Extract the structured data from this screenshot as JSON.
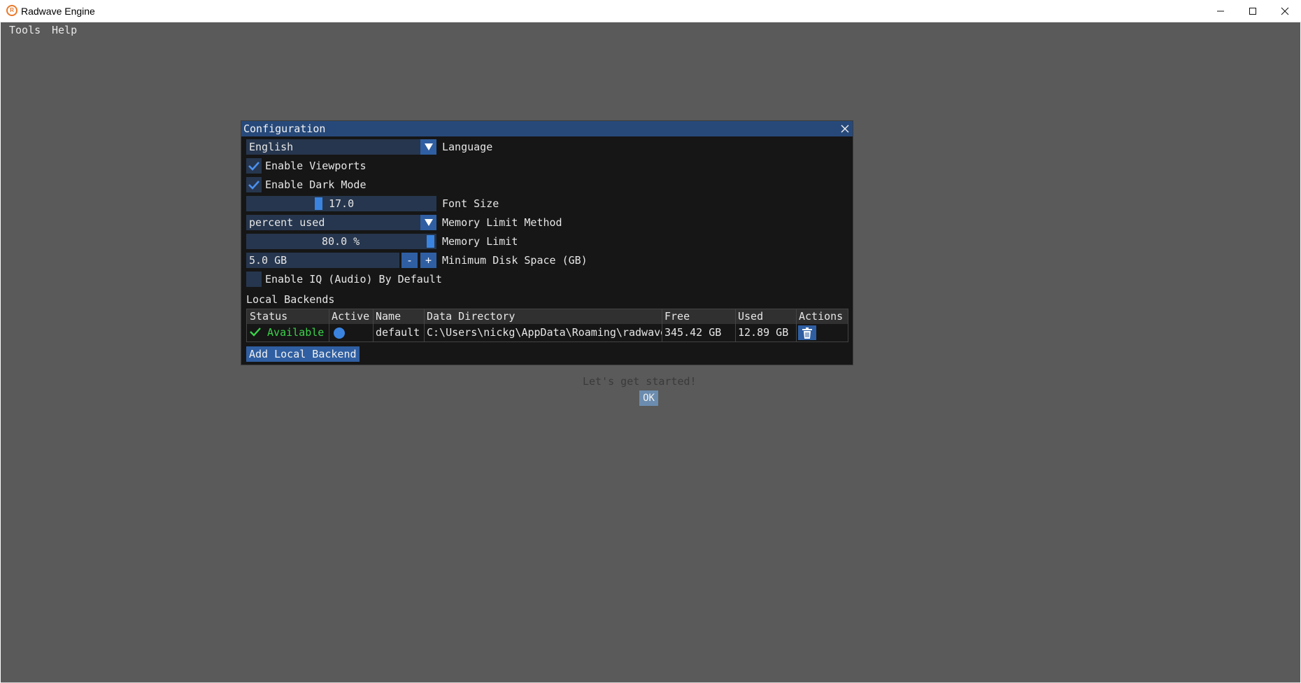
{
  "window": {
    "title": "Radwave Engine",
    "icon": "radwave-logo-icon"
  },
  "menu": {
    "items": [
      {
        "label": "Tools"
      },
      {
        "label": "Help"
      }
    ]
  },
  "background_modal": {
    "text": "Let's get started!",
    "ok_label": "OK"
  },
  "config": {
    "title": "Configuration",
    "language": {
      "value": "English",
      "label": "Language"
    },
    "enable_viewports": {
      "label": "Enable Viewports",
      "checked": true
    },
    "enable_dark_mode": {
      "label": "Enable Dark Mode",
      "checked": true
    },
    "font_size": {
      "value": "17.0",
      "label": "Font Size"
    },
    "memory_limit_method": {
      "value": "percent used",
      "label": "Memory Limit Method"
    },
    "memory_limit": {
      "value": "80.0 %",
      "label": "Memory Limit"
    },
    "min_disk_space": {
      "value": "5.0 GB",
      "label": "Minimum Disk Space (GB)",
      "minus": "-",
      "plus": "+"
    },
    "enable_iq": {
      "label": "Enable IQ (Audio) By Default",
      "checked": false
    },
    "local_backends": {
      "section_label": "Local Backends",
      "columns": [
        "Status",
        "Active",
        "Name",
        "Data Directory",
        "Free",
        "Used",
        "Actions"
      ],
      "rows": [
        {
          "status": "Available",
          "active": true,
          "name": "default",
          "data_directory": "C:\\Users\\nickg\\AppData\\Roaming\\radwave",
          "free": "345.42 GB",
          "used": "12.89 GB"
        }
      ],
      "add_label": "Add Local Backend"
    }
  },
  "colors": {
    "accent": "#2f5fa2",
    "title_bar": "#27497a",
    "status_ok": "#3ad24a",
    "frame_bg": "#26364e"
  }
}
